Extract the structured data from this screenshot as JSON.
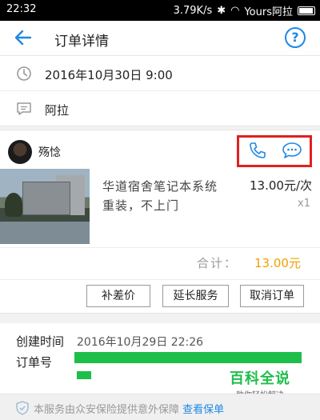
{
  "statusbar": {
    "time": "22:32",
    "net": "3.79K/s",
    "carrier": "Yours阿拉"
  },
  "header": {
    "title": "订单详情"
  },
  "schedule": {
    "time": "2016年10月30日 9:00",
    "address": "阿拉"
  },
  "provider": {
    "name": "殇惗"
  },
  "service": {
    "name": "华道宿舍笔记本系统重装，不上门",
    "price": "13.00元/次",
    "qty": "x1"
  },
  "total": {
    "label": "合计：",
    "value": "13.00元"
  },
  "actions": {
    "supplement": "补差价",
    "extend": "延长服务",
    "cancel": "取消订单"
  },
  "order": {
    "created_label": "创建时间",
    "created_value": "2016年10月29日 22:26",
    "number_label": "订单号"
  },
  "watermark": {
    "main": "百科全说",
    "sub": "助你轻松解决"
  },
  "footer": {
    "text": "本服务由众安保险提供意外保障",
    "link": "查看保单"
  },
  "colors": {
    "accent": "#1e88e5",
    "price": "#f0a000",
    "highlight": "#e02020",
    "redaction": "#1ebe4a"
  }
}
